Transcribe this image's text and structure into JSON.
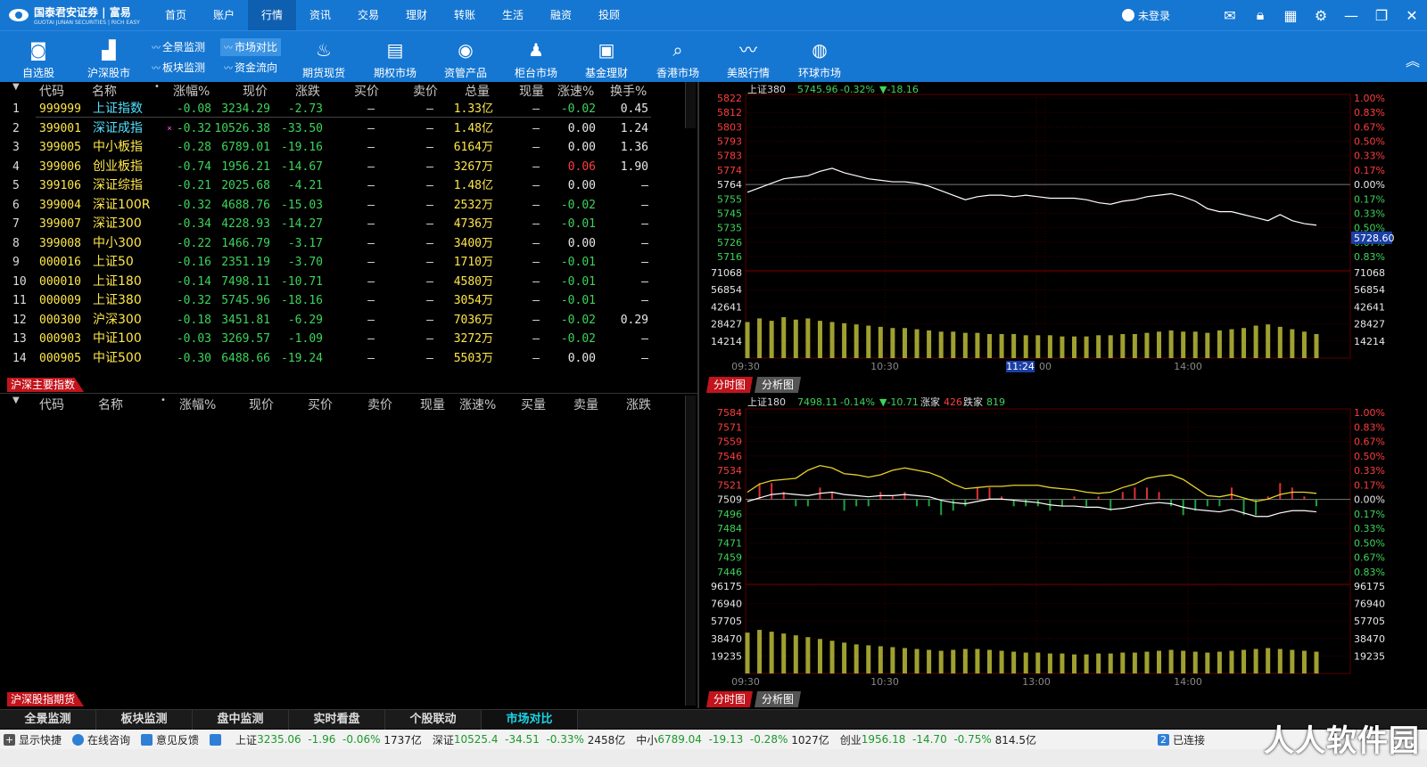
{
  "topbar": {
    "brand": "国泰君安证券 | 富易",
    "brand_sub": "GUOTAI JUNAN SECURITIES | RICH EASY",
    "menu": [
      "首页",
      "账户",
      "行情",
      "资讯",
      "交易",
      "理财",
      "转账",
      "生活",
      "融资",
      "投顾"
    ],
    "active_menu": "行情",
    "user_label": "未登录",
    "icons": [
      "mail-icon",
      "lock-icon",
      "grid-icon",
      "gear-icon",
      "minimize-icon",
      "restore-icon",
      "close-icon"
    ]
  },
  "toolbar": {
    "tools": [
      "自选股",
      "沪深股市",
      "期货现货",
      "期权市场",
      "资管产品",
      "柜台市场",
      "基金理财",
      "香港市场",
      "美股行情",
      "环球市场"
    ],
    "mini": [
      "全景监测",
      "市场对比",
      "板块监测",
      "资金流向"
    ],
    "active_mini": "市场对比"
  },
  "index_table": {
    "headers": [
      "代码",
      "名称",
      "涨幅%",
      "现价",
      "涨跌",
      "买价",
      "卖价",
      "总量",
      "现量",
      "涨速%",
      "换手%"
    ],
    "rows": [
      {
        "idx": "1",
        "code": "999999",
        "name": "上证指数",
        "pct": "-0.08",
        "price": "3234.29",
        "chg": "-2.73",
        "bid": "—",
        "ask": "—",
        "vol": "1.33亿",
        "cur": "—",
        "speed": "-0.02",
        "turn": "0.45"
      },
      {
        "idx": "2",
        "code": "399001",
        "name": "深证成指",
        "pct": "-0.32",
        "price": "10526.38",
        "chg": "-33.50",
        "bid": "—",
        "ask": "—",
        "vol": "1.48亿",
        "cur": "—",
        "speed": "0.00",
        "turn": "1.24"
      },
      {
        "idx": "3",
        "code": "399005",
        "name": "中小板指",
        "pct": "-0.28",
        "price": "6789.01",
        "chg": "-19.16",
        "bid": "—",
        "ask": "—",
        "vol": "6164万",
        "cur": "—",
        "speed": "0.00",
        "turn": "1.36"
      },
      {
        "idx": "4",
        "code": "399006",
        "name": "创业板指",
        "pct": "-0.74",
        "price": "1956.21",
        "chg": "-14.67",
        "bid": "—",
        "ask": "—",
        "vol": "3267万",
        "cur": "—",
        "speed": "0.06",
        "turn": "1.90"
      },
      {
        "idx": "5",
        "code": "399106",
        "name": "深证综指",
        "pct": "-0.21",
        "price": "2025.68",
        "chg": "-4.21",
        "bid": "—",
        "ask": "—",
        "vol": "1.48亿",
        "cur": "—",
        "speed": "0.00",
        "turn": "—"
      },
      {
        "idx": "6",
        "code": "399004",
        "name": "深证100R",
        "pct": "-0.32",
        "price": "4688.76",
        "chg": "-15.03",
        "bid": "—",
        "ask": "—",
        "vol": "2532万",
        "cur": "—",
        "speed": "-0.02",
        "turn": "—"
      },
      {
        "idx": "7",
        "code": "399007",
        "name": "深证300",
        "pct": "-0.34",
        "price": "4228.93",
        "chg": "-14.27",
        "bid": "—",
        "ask": "—",
        "vol": "4736万",
        "cur": "—",
        "speed": "-0.01",
        "turn": "—"
      },
      {
        "idx": "8",
        "code": "399008",
        "name": "中小300",
        "pct": "-0.22",
        "price": "1466.79",
        "chg": "-3.17",
        "bid": "—",
        "ask": "—",
        "vol": "3400万",
        "cur": "—",
        "speed": "0.00",
        "turn": "—"
      },
      {
        "idx": "9",
        "code": "000016",
        "name": "上证50",
        "pct": "-0.16",
        "price": "2351.19",
        "chg": "-3.70",
        "bid": "—",
        "ask": "—",
        "vol": "1710万",
        "cur": "—",
        "speed": "-0.01",
        "turn": "—"
      },
      {
        "idx": "10",
        "code": "000010",
        "name": "上证180",
        "pct": "-0.14",
        "price": "7498.11",
        "chg": "-10.71",
        "bid": "—",
        "ask": "—",
        "vol": "4580万",
        "cur": "—",
        "speed": "-0.01",
        "turn": "—"
      },
      {
        "idx": "11",
        "code": "000009",
        "name": "上证380",
        "pct": "-0.32",
        "price": "5745.96",
        "chg": "-18.16",
        "bid": "—",
        "ask": "—",
        "vol": "3054万",
        "cur": "—",
        "speed": "-0.01",
        "turn": "—"
      },
      {
        "idx": "12",
        "code": "000300",
        "name": "沪深300",
        "pct": "-0.18",
        "price": "3451.81",
        "chg": "-6.29",
        "bid": "—",
        "ask": "—",
        "vol": "7036万",
        "cur": "—",
        "speed": "-0.02",
        "turn": "0.29"
      },
      {
        "idx": "13",
        "code": "000903",
        "name": "中证100",
        "pct": "-0.03",
        "price": "3269.57",
        "chg": "-1.09",
        "bid": "—",
        "ask": "—",
        "vol": "3272万",
        "cur": "—",
        "speed": "-0.02",
        "turn": "—"
      },
      {
        "idx": "14",
        "code": "000905",
        "name": "中证500",
        "pct": "-0.30",
        "price": "6488.66",
        "chg": "-19.24",
        "bid": "—",
        "ask": "—",
        "vol": "5503万",
        "cur": "—",
        "speed": "0.00",
        "turn": "—"
      }
    ],
    "section_tag": "沪深主要指数"
  },
  "futures_table": {
    "headers": [
      "代码",
      "名称",
      "涨幅%",
      "现价",
      "买价",
      "卖价",
      "现量",
      "涨速%",
      "买量",
      "卖量",
      "涨跌"
    ],
    "section_tag": "沪深股指期货"
  },
  "chart_data": [
    {
      "type": "line",
      "name": "上证380",
      "header_price": "5745.96",
      "header_pct": "-0.32%",
      "header_chg": "▼-18.16",
      "y_ticks": [
        "5822",
        "5812",
        "5803",
        "5793",
        "5783",
        "5774",
        "5764",
        "5755",
        "5745",
        "5735",
        "5726",
        "5716"
      ],
      "pct_ticks": [
        "1.00%",
        "0.83%",
        "0.67%",
        "0.50%",
        "0.33%",
        "0.17%",
        "0.00%",
        "0.17%",
        "0.33%",
        "0.50%",
        "0.67%",
        "0.83%"
      ],
      "ylim": [
        5716,
        5822
      ],
      "prev_close": 5764,
      "cursor_price": "5728.60",
      "vol_ticks": [
        "71068",
        "56854",
        "42641",
        "28427",
        "14214"
      ],
      "vol_max": 71068,
      "x_ticks": [
        "09:30",
        "10:30",
        "11:24",
        "00",
        "14:00"
      ],
      "price_series": [
        5759,
        5762,
        5765,
        5768,
        5769,
        5770,
        5773,
        5775,
        5772,
        5770,
        5768,
        5767,
        5766,
        5766,
        5765,
        5763,
        5760,
        5757,
        5754,
        5756,
        5757,
        5757,
        5756,
        5757,
        5756,
        5755,
        5755,
        5755,
        5754,
        5752,
        5751,
        5753,
        5754,
        5756,
        5757,
        5758,
        5756,
        5753,
        5748,
        5746,
        5746,
        5744,
        5742,
        5740,
        5744,
        5740,
        5738,
        5737
      ],
      "volume_series": [
        30000,
        33000,
        31000,
        34000,
        32000,
        33000,
        31000,
        30000,
        29000,
        28000,
        27000,
        26000,
        25000,
        25000,
        24000,
        23000,
        22000,
        22000,
        21000,
        21000,
        20000,
        20000,
        20000,
        19000,
        19000,
        19000,
        18000,
        18000,
        18000,
        19000,
        19000,
        20000,
        20000,
        21000,
        22000,
        23000,
        22000,
        22000,
        21000,
        23000,
        24000,
        25000,
        27000,
        28000,
        26000,
        24000,
        22000,
        20000
      ]
    },
    {
      "type": "line",
      "name": "上证180",
      "header_price": "7498.11",
      "header_pct": "-0.14%",
      "header_chg": "▼-10.71",
      "header_up_label": "涨家",
      "header_up": "426",
      "header_down_label": "跌家",
      "header_down": "819",
      "y_ticks": [
        "7584",
        "7571",
        "7559",
        "7546",
        "7534",
        "7521",
        "7509",
        "7496",
        "7484",
        "7471",
        "7459",
        "7446"
      ],
      "pct_ticks": [
        "1.00%",
        "0.83%",
        "0.67%",
        "0.50%",
        "0.33%",
        "0.17%",
        "0.00%",
        "0.17%",
        "0.33%",
        "0.50%",
        "0.67%",
        "0.83%"
      ],
      "ylim": [
        7446,
        7584
      ],
      "prev_close": 7509,
      "vol_ticks": [
        "96175",
        "76940",
        "57705",
        "38470",
        "19235"
      ],
      "vol_max": 96175,
      "x_ticks": [
        "09:30",
        "10:30",
        "13:00",
        "14:00"
      ],
      "price_series": [
        7507,
        7510,
        7513,
        7514,
        7513,
        7512,
        7514,
        7515,
        7513,
        7512,
        7511,
        7512,
        7512,
        7513,
        7512,
        7511,
        7508,
        7506,
        7505,
        7507,
        7509,
        7509,
        7508,
        7507,
        7506,
        7504,
        7503,
        7503,
        7502,
        7502,
        7500,
        7501,
        7503,
        7505,
        7506,
        7505,
        7502,
        7500,
        7499,
        7498,
        7500,
        7497,
        7494,
        7494,
        7497,
        7499,
        7499,
        7498
      ],
      "avg_series": [
        7515,
        7522,
        7525,
        7526,
        7527,
        7534,
        7538,
        7536,
        7531,
        7530,
        7528,
        7530,
        7534,
        7536,
        7534,
        7532,
        7528,
        7522,
        7518,
        7519,
        7520,
        7520,
        7521,
        7521,
        7521,
        7519,
        7518,
        7517,
        7515,
        7514,
        7515,
        7519,
        7522,
        7527,
        7529,
        7530,
        7526,
        7519,
        7512,
        7511,
        7513,
        7510,
        7507,
        7509,
        7513,
        7515,
        7515,
        7514
      ],
      "volume_series": [
        45000,
        48000,
        46000,
        44000,
        42000,
        40000,
        38000,
        36000,
        34000,
        32000,
        31000,
        30000,
        29000,
        28000,
        27000,
        26000,
        25000,
        26000,
        27000,
        27000,
        26000,
        25000,
        24000,
        23000,
        23000,
        22000,
        22000,
        21000,
        21000,
        22000,
        22000,
        23000,
        23000,
        24000,
        25000,
        26000,
        25000,
        24000,
        23000,
        24000,
        25000,
        26000,
        27000,
        28000,
        27000,
        26000,
        25000,
        24000
      ]
    }
  ],
  "chart_tabs": [
    "分时图",
    "分析图"
  ],
  "bottom_tabs": [
    "全景监测",
    "板块监测",
    "盘中监测",
    "实时看盘",
    "个股联动",
    "市场对比"
  ],
  "active_bottom_tab": "市场对比",
  "statusbar": {
    "show_shortcut": "显示快捷",
    "online": "在线咨询",
    "feedback": "意见反馈",
    "sh_label": "上证",
    "sh_price": "3235.06",
    "sh_chg": "-1.96",
    "sh_pct": "-0.06%",
    "sh_amt": "1737亿",
    "sz_label": "深证",
    "sz_price": "10525.4",
    "sz_chg": "-34.51",
    "sz_pct": "-0.33%",
    "sz_amt": "2458亿",
    "zx_label": "中小",
    "zx_price": "6789.04",
    "zx_chg": "-19.13",
    "zx_pct": "-0.28%",
    "zx_amt": "1027亿",
    "cy_label": "创业",
    "cy_price": "1956.18",
    "cy_chg": "-14.70",
    "cy_pct": "-0.75%",
    "cy_amt": "814.5亿",
    "conn_count": "2",
    "conn_label": "已连接",
    "watermark": "人人软件园"
  }
}
